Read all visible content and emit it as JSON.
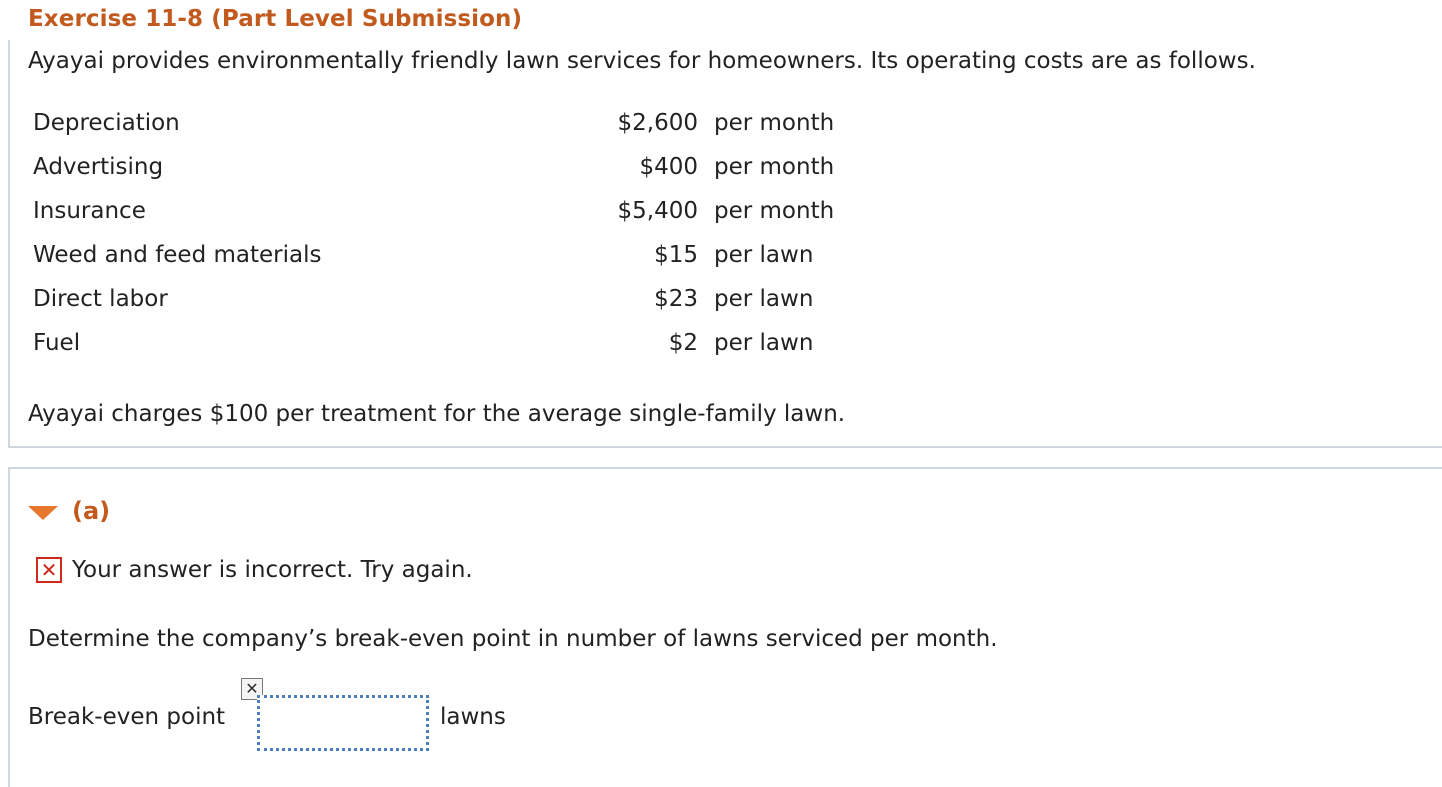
{
  "exercise": {
    "title": "Exercise 11-8 (Part Level Submission)"
  },
  "problem": {
    "intro": "Ayayai provides environmentally friendly lawn services for homeowners. Its operating costs are as follows.",
    "costs": [
      {
        "label": "Depreciation",
        "amount": "$2,600",
        "unit": "per month"
      },
      {
        "label": "Advertising",
        "amount": "$400",
        "unit": "per month"
      },
      {
        "label": "Insurance",
        "amount": "$5,400",
        "unit": "per month"
      },
      {
        "label": "Weed and feed materials",
        "amount": "$15",
        "unit": "per lawn"
      },
      {
        "label": "Direct labor",
        "amount": "$23",
        "unit": "per lawn"
      },
      {
        "label": "Fuel",
        "amount": "$2",
        "unit": "per lawn"
      }
    ],
    "charge_text": "Ayayai charges $100 per treatment for the average single-family lawn."
  },
  "part_a": {
    "label": "(a)",
    "toggle_icon": "triangle-down-icon",
    "feedback": {
      "icon": "x-icon",
      "icon_glyph": "✕",
      "text": "Your answer is incorrect.  Try again."
    },
    "question": "Determine the company’s break-even point in number of lawns serviced per month.",
    "answer": {
      "label": "Break-even point",
      "value": "",
      "unit": "lawns",
      "incorrect_marker_glyph": "✕"
    }
  },
  "colors": {
    "title": "#c25a1e",
    "toggle": "#e8772e",
    "error": "#d0281c",
    "input_border": "#4f7fb8",
    "panel_border": "#cfd6de"
  }
}
